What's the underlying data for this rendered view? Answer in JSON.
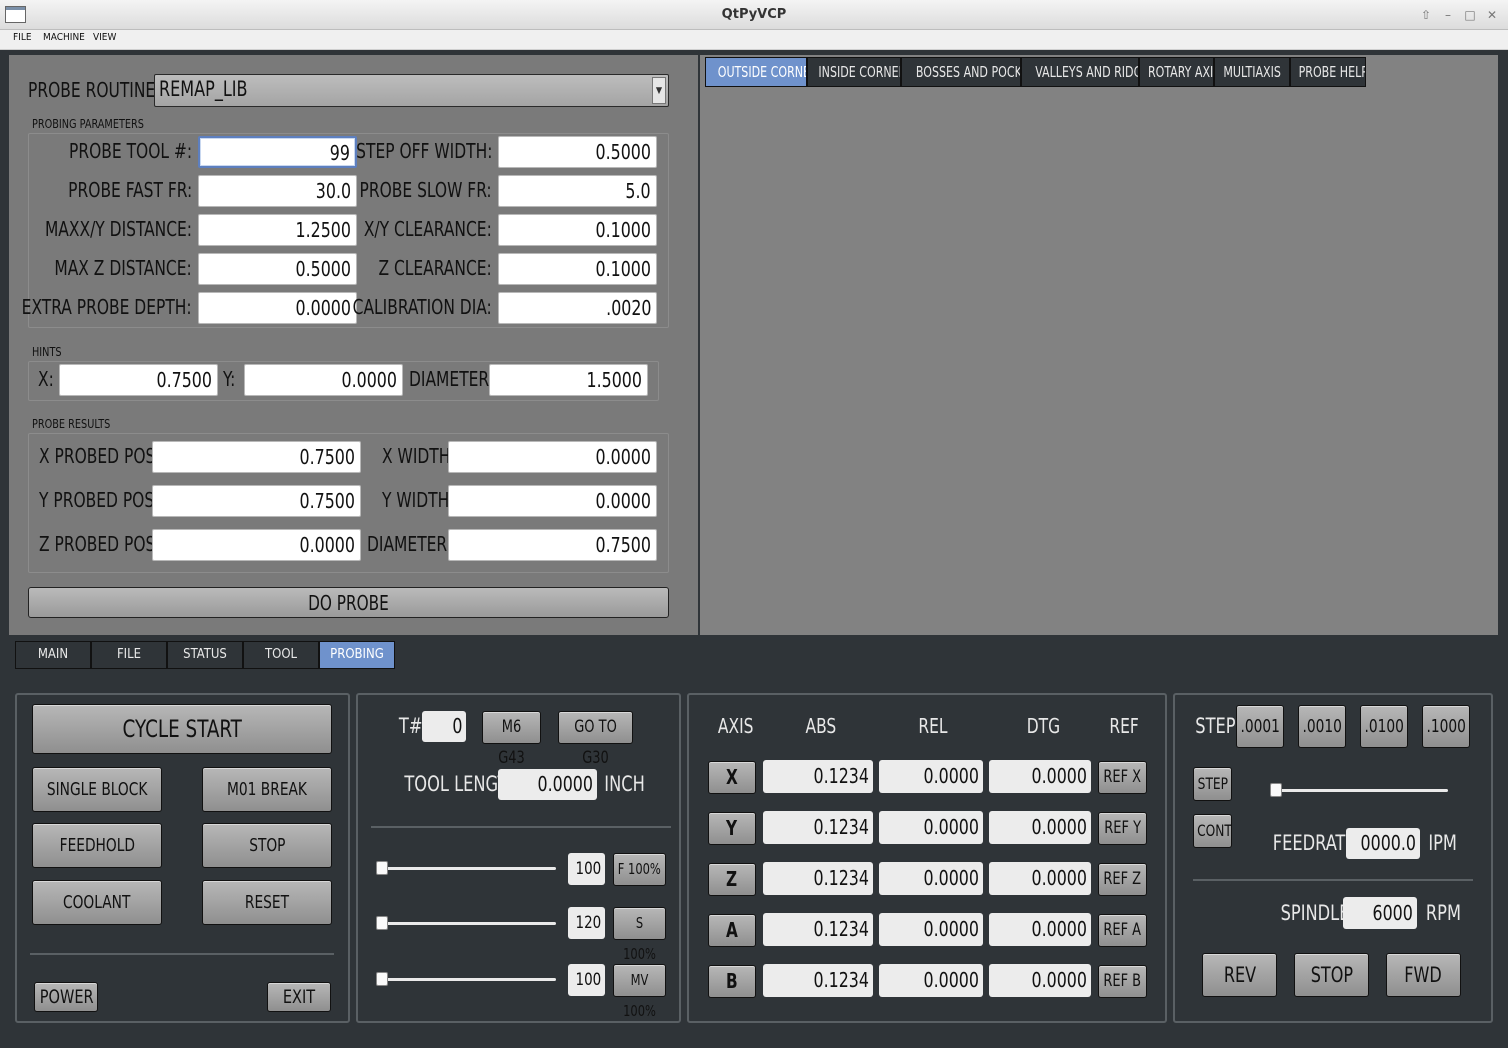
{
  "window": {
    "title": "QtPyVCP"
  },
  "menu": [
    "FILE",
    "MACHINE",
    "VIEW"
  ],
  "probe": {
    "routine_label": "PROBE ROUTINE:",
    "routine_value": "REMAP_LIB",
    "params_title": "PROBING PARAMETERS",
    "params": [
      {
        "l1": "PROBE TOOL #:",
        "v1": "99",
        "l2": "STEP OFF WIDTH:",
        "v2": "0.5000"
      },
      {
        "l1": "PROBE FAST FR:",
        "v1": "30.0",
        "l2": "PROBE SLOW FR:",
        "v2": "5.0"
      },
      {
        "l1": "MAXX/Y DISTANCE:",
        "v1": "1.2500",
        "l2": "X/Y CLEARANCE:",
        "v2": "0.1000"
      },
      {
        "l1": "MAX Z DISTANCE:",
        "v1": "0.5000",
        "l2": "Z CLEARANCE:",
        "v2": "0.1000"
      },
      {
        "l1": "EXTRA PROBE DEPTH:",
        "v1": "0.0000",
        "l2": "CALIBRATION DIA:",
        "v2": ".0020"
      }
    ],
    "hints_title": "HINTS",
    "hints": {
      "x_label": "X:",
      "x": "0.7500",
      "y_label": "Y:",
      "y": "0.0000",
      "dia_label": "DIAMETER",
      "dia": "1.5000"
    },
    "results_title": "PROBE RESULTS",
    "results": [
      {
        "l1": "X PROBED POS:",
        "v1": "0.7500",
        "l2": "X WIDTH",
        "v2": "0.0000"
      },
      {
        "l1": "Y PROBED POS:",
        "v1": "0.7500",
        "l2": "Y WIDTH",
        "v2": "0.0000"
      },
      {
        "l1": "Z PROBED POS:",
        "v1": "0.0000",
        "l2": "DIAMETER",
        "v2": "0.7500"
      }
    ],
    "do_probe": "DO PROBE"
  },
  "probe_tabs": [
    "OUTSIDE CORNERS",
    "INSIDE CORNERS",
    "BOSSES AND POCKETS",
    "VALLEYS AND RIDGES",
    "ROTARY AXIS",
    "MULTIAXIS",
    "PROBE HELP"
  ],
  "main_tabs": [
    "MAIN",
    "FILE",
    "STATUS",
    "TOOL",
    "PROBING"
  ],
  "controls": {
    "cycle_start": "CYCLE START",
    "single_block": "SINGLE BLOCK",
    "m01_break": "M01 BREAK",
    "feedhold": "FEEDHOLD",
    "stop": "STOP",
    "coolant": "COOLANT",
    "reset": "RESET",
    "power": "POWER",
    "exit": "EXIT"
  },
  "tool": {
    "t_label": "T#",
    "t_value": "0",
    "m6g43": "M6 G43",
    "goto_g30": "GO TO G30",
    "length_label": "TOOL LENGTH",
    "length_value": "0.0000",
    "length_unit": "INCH",
    "overrides": [
      {
        "value": "100",
        "button": "F 100%"
      },
      {
        "value": "120",
        "button": "S 100%"
      },
      {
        "value": "100",
        "button": "MV 100%"
      }
    ]
  },
  "dro": {
    "headers": [
      "AXIS",
      "ABS",
      "REL",
      "DTG",
      "REF"
    ],
    "rows": [
      {
        "axis": "X",
        "abs": "0.1234",
        "rel": "0.0000",
        "dtg": "0.0000",
        "ref": "REF X"
      },
      {
        "axis": "Y",
        "abs": "0.1234",
        "rel": "0.0000",
        "dtg": "0.0000",
        "ref": "REF Y"
      },
      {
        "axis": "Z",
        "abs": "0.1234",
        "rel": "0.0000",
        "dtg": "0.0000",
        "ref": "REF Z"
      },
      {
        "axis": "A",
        "abs": "0.1234",
        "rel": "0.0000",
        "dtg": "0.0000",
        "ref": "REF A"
      },
      {
        "axis": "B",
        "abs": "0.1234",
        "rel": "0.0000",
        "dtg": "0.0000",
        "ref": "REF B"
      }
    ]
  },
  "jog": {
    "step_label": "STEP",
    "steps": [
      ".0001",
      ".0010",
      ".0100",
      ".1000"
    ],
    "step_mode": "STEP",
    "cont_mode": "CONT",
    "feedrate_label": "FEEDRATE",
    "feedrate_value": "0000.0",
    "feedrate_unit": "IPM",
    "spindle_label": "SPINDLE",
    "spindle_value": "6000",
    "spindle_unit": "RPM",
    "rev": "REV",
    "stop": "STOP",
    "fwd": "FWD"
  },
  "colors": {
    "accent": "#6f92cc",
    "panel_bg": "#2f3438",
    "probe_bg": "#7a7a7a"
  }
}
